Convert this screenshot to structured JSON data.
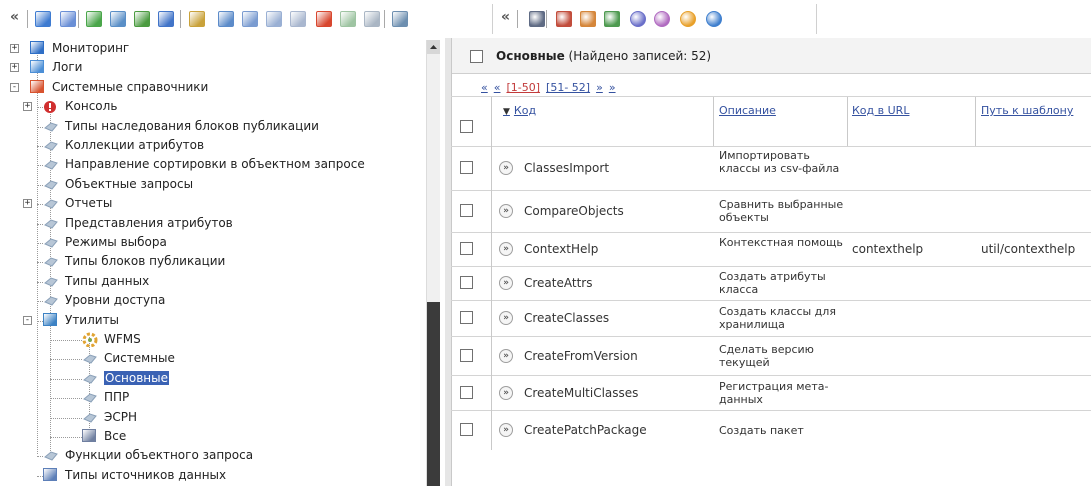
{
  "toolbar": {
    "left_collapse": "«",
    "mid_collapse": "«",
    "buttons": [
      {
        "icon": "home-icon",
        "color": "#3e7bd1"
      },
      {
        "icon": "document-icon",
        "color": "#6a8fd6"
      },
      {
        "icon": "new-document-icon",
        "color": "#4aa64a"
      },
      {
        "icon": "settings-gear-icon",
        "color": "#5a8fc7"
      },
      {
        "icon": "tools-icon",
        "color": "#4b9b40"
      },
      {
        "icon": "edit-icon",
        "color": "#4174c8"
      },
      {
        "icon": "search-icon",
        "color": "#c9a23a"
      },
      {
        "icon": "copy-icon",
        "color": "#5c8bc9"
      },
      {
        "icon": "cut-icon",
        "color": "#7a9bd0"
      },
      {
        "icon": "paste-icon",
        "color": "#9ab0d4"
      },
      {
        "icon": "clipboard-icon",
        "color": "#a9b7cf"
      },
      {
        "icon": "delete-icon",
        "color": "#d8472f"
      },
      {
        "icon": "refresh-icon",
        "color": "#9ec4a2"
      },
      {
        "icon": "sync-icon",
        "color": "#aab6c4"
      },
      {
        "icon": "print-icon",
        "color": "#6d8fb0"
      }
    ],
    "buttons2": [
      {
        "icon": "calendar-icon",
        "color": "#5f6b84"
      },
      {
        "icon": "class-icon",
        "color": "#c24d3c"
      },
      {
        "icon": "hierarchy-icon",
        "color": "#d5863a"
      },
      {
        "icon": "tree-icon",
        "color": "#4e9a50"
      },
      {
        "icon": "package-icon",
        "color": "#6a6fc9"
      },
      {
        "icon": "import-icon",
        "color": "#b06ac0"
      },
      {
        "icon": "arrow-down-icon",
        "color": "#e8a02a"
      },
      {
        "icon": "arrow-up-icon",
        "color": "#3f7fce"
      }
    ]
  },
  "tree": {
    "items": [
      {
        "label": "Мониторинг",
        "icon": "monitor-icon",
        "expander": "+",
        "level": 0
      },
      {
        "label": "Логи",
        "icon": "log-icon",
        "expander": "+",
        "level": 0
      },
      {
        "label": "Системные справочники",
        "icon": "system-reference-icon",
        "expander": "−",
        "level": 0
      },
      {
        "label": "Консоль",
        "icon": "console-icon",
        "expander": "+",
        "level": 1
      },
      {
        "label": "Типы наследования блоков публикации",
        "icon": "ref-item-icon",
        "level": 1
      },
      {
        "label": "Коллекции атрибутов",
        "icon": "ref-item-icon",
        "level": 1
      },
      {
        "label": "Направление сортировки в объектном запросе",
        "icon": "ref-item-icon",
        "level": 1
      },
      {
        "label": "Объектные запросы",
        "icon": "ref-item-icon",
        "level": 1
      },
      {
        "label": "Отчеты",
        "icon": "ref-item-icon",
        "expander": "+",
        "level": 1
      },
      {
        "label": "Представления атрибутов",
        "icon": "ref-item-icon",
        "level": 1
      },
      {
        "label": "Режимы выбора",
        "icon": "ref-item-icon",
        "level": 1
      },
      {
        "label": "Типы блоков публикации",
        "icon": "ref-item-icon",
        "level": 1
      },
      {
        "label": "Типы данных",
        "icon": "ref-item-icon",
        "level": 1
      },
      {
        "label": "Уровни доступа",
        "icon": "ref-item-icon",
        "level": 1
      },
      {
        "label": "Утилиты",
        "icon": "utilities-icon",
        "expander": "−",
        "level": 1
      },
      {
        "label": "WFMS",
        "icon": "wfms-icon",
        "level": 2
      },
      {
        "label": "Системные",
        "icon": "ref-item-icon",
        "level": 2
      },
      {
        "label": "Основные",
        "icon": "ref-item-icon",
        "level": 2,
        "selected": true
      },
      {
        "label": "ППР",
        "icon": "ref-item-icon",
        "level": 2
      },
      {
        "label": "ЭСРН",
        "icon": "ref-item-icon",
        "level": 2
      },
      {
        "label": "Все",
        "icon": "all-items-icon",
        "level": 2
      },
      {
        "label": "Функции объектного запроса",
        "icon": "ref-item-icon",
        "level": 1
      },
      {
        "label": "Типы источников данных",
        "icon": "data-source-icon",
        "level": 1
      }
    ]
  },
  "main": {
    "title_bold": "Основные",
    "title_rest": " (Найдено записей: 52)",
    "pager": [
      {
        "text": "«",
        "type": "lnk"
      },
      {
        "text": "«",
        "type": "lnk"
      },
      {
        "text": "[1-50]",
        "type": "cur"
      },
      {
        "text": "[51- 52]",
        "type": "lnk"
      },
      {
        "text": "»",
        "type": "lnk"
      },
      {
        "text": "»",
        "type": "lnk"
      }
    ],
    "columns": {
      "sort_arrow": "▼",
      "code": "Код",
      "description": "Описание",
      "url_code": "Код в URL",
      "template_path": "Путь к шаблону"
    },
    "open_glyph": "»",
    "rows": [
      {
        "code": "ClassesImport",
        "description": "Импортировать классы из csv-файла",
        "url_code": "",
        "template_path": ""
      },
      {
        "code": "CompareObjects",
        "description": "Сравнить выбранные объекты",
        "url_code": "",
        "template_path": ""
      },
      {
        "code": "ContextHelp",
        "description": "Контекстная помощь",
        "url_code": "contexthelp",
        "template_path": "util/contexthelp"
      },
      {
        "code": "CreateAttrs",
        "description": "Создать атрибуты класса",
        "url_code": "",
        "template_path": ""
      },
      {
        "code": "CreateClasses",
        "description": "Создать классы для хранилища",
        "url_code": "",
        "template_path": ""
      },
      {
        "code": "CreateFromVersion",
        "description": "Сделать версию текущей",
        "url_code": "",
        "template_path": ""
      },
      {
        "code": "CreateMultiClasses",
        "description": "Регистрация мета-данных",
        "url_code": "",
        "template_path": ""
      },
      {
        "code": "CreatePatchPackage",
        "description": "Создать пакет",
        "url_code": "",
        "template_path": ""
      }
    ]
  }
}
